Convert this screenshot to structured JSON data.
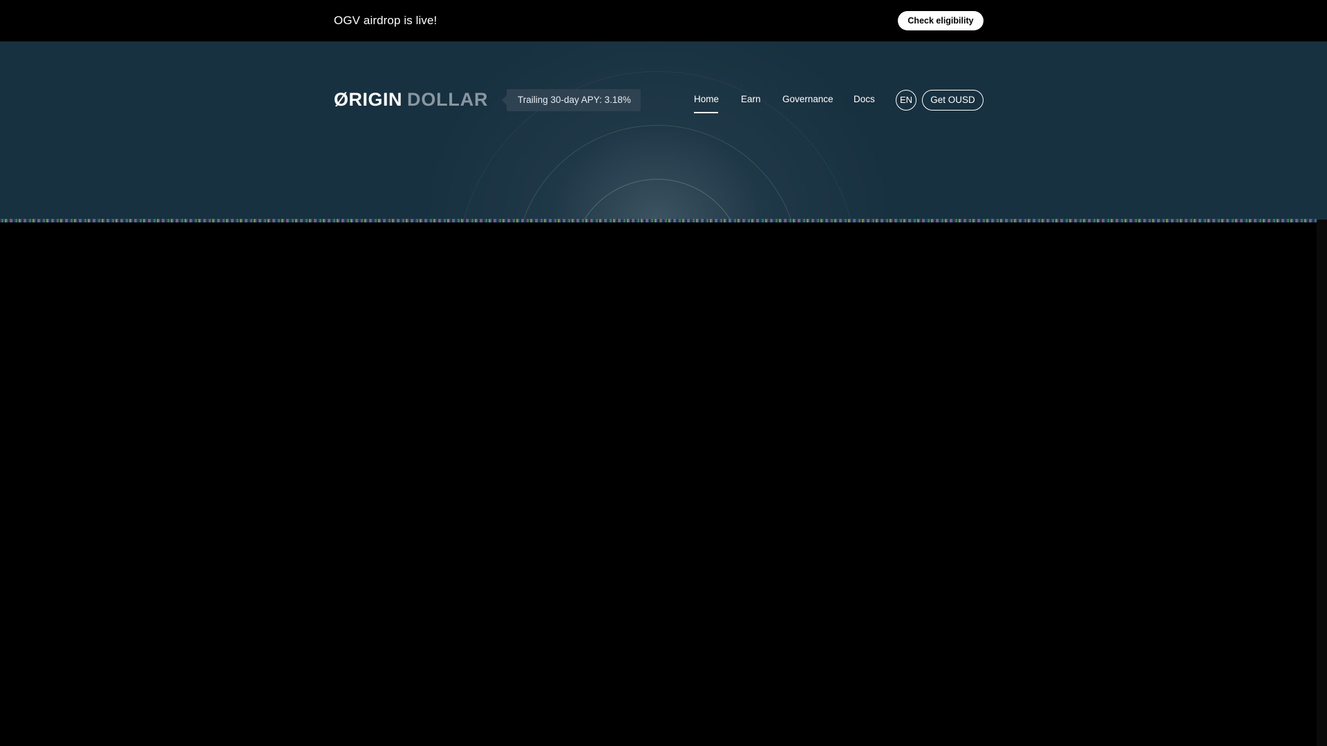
{
  "banner": {
    "text": "OGV airdrop is live!",
    "button_label": "Check eligibility"
  },
  "header": {
    "logo_origin": "ØRIGIN",
    "logo_dollar": "DOLLAR",
    "apy_badge": "Trailing 30-day APY: 3.18%",
    "nav": {
      "home": "Home",
      "earn": "Earn",
      "governance": "Governance",
      "docs": "Docs"
    },
    "active_nav": "Home",
    "language_label": "EN",
    "cta_label": "Get OUSD"
  },
  "colors": {
    "hero_background": "#183140",
    "page_background": "#000000",
    "banner_button": "#ffffff",
    "apy_badge": "#2e4251",
    "logo_dollar": "#8897a1"
  }
}
